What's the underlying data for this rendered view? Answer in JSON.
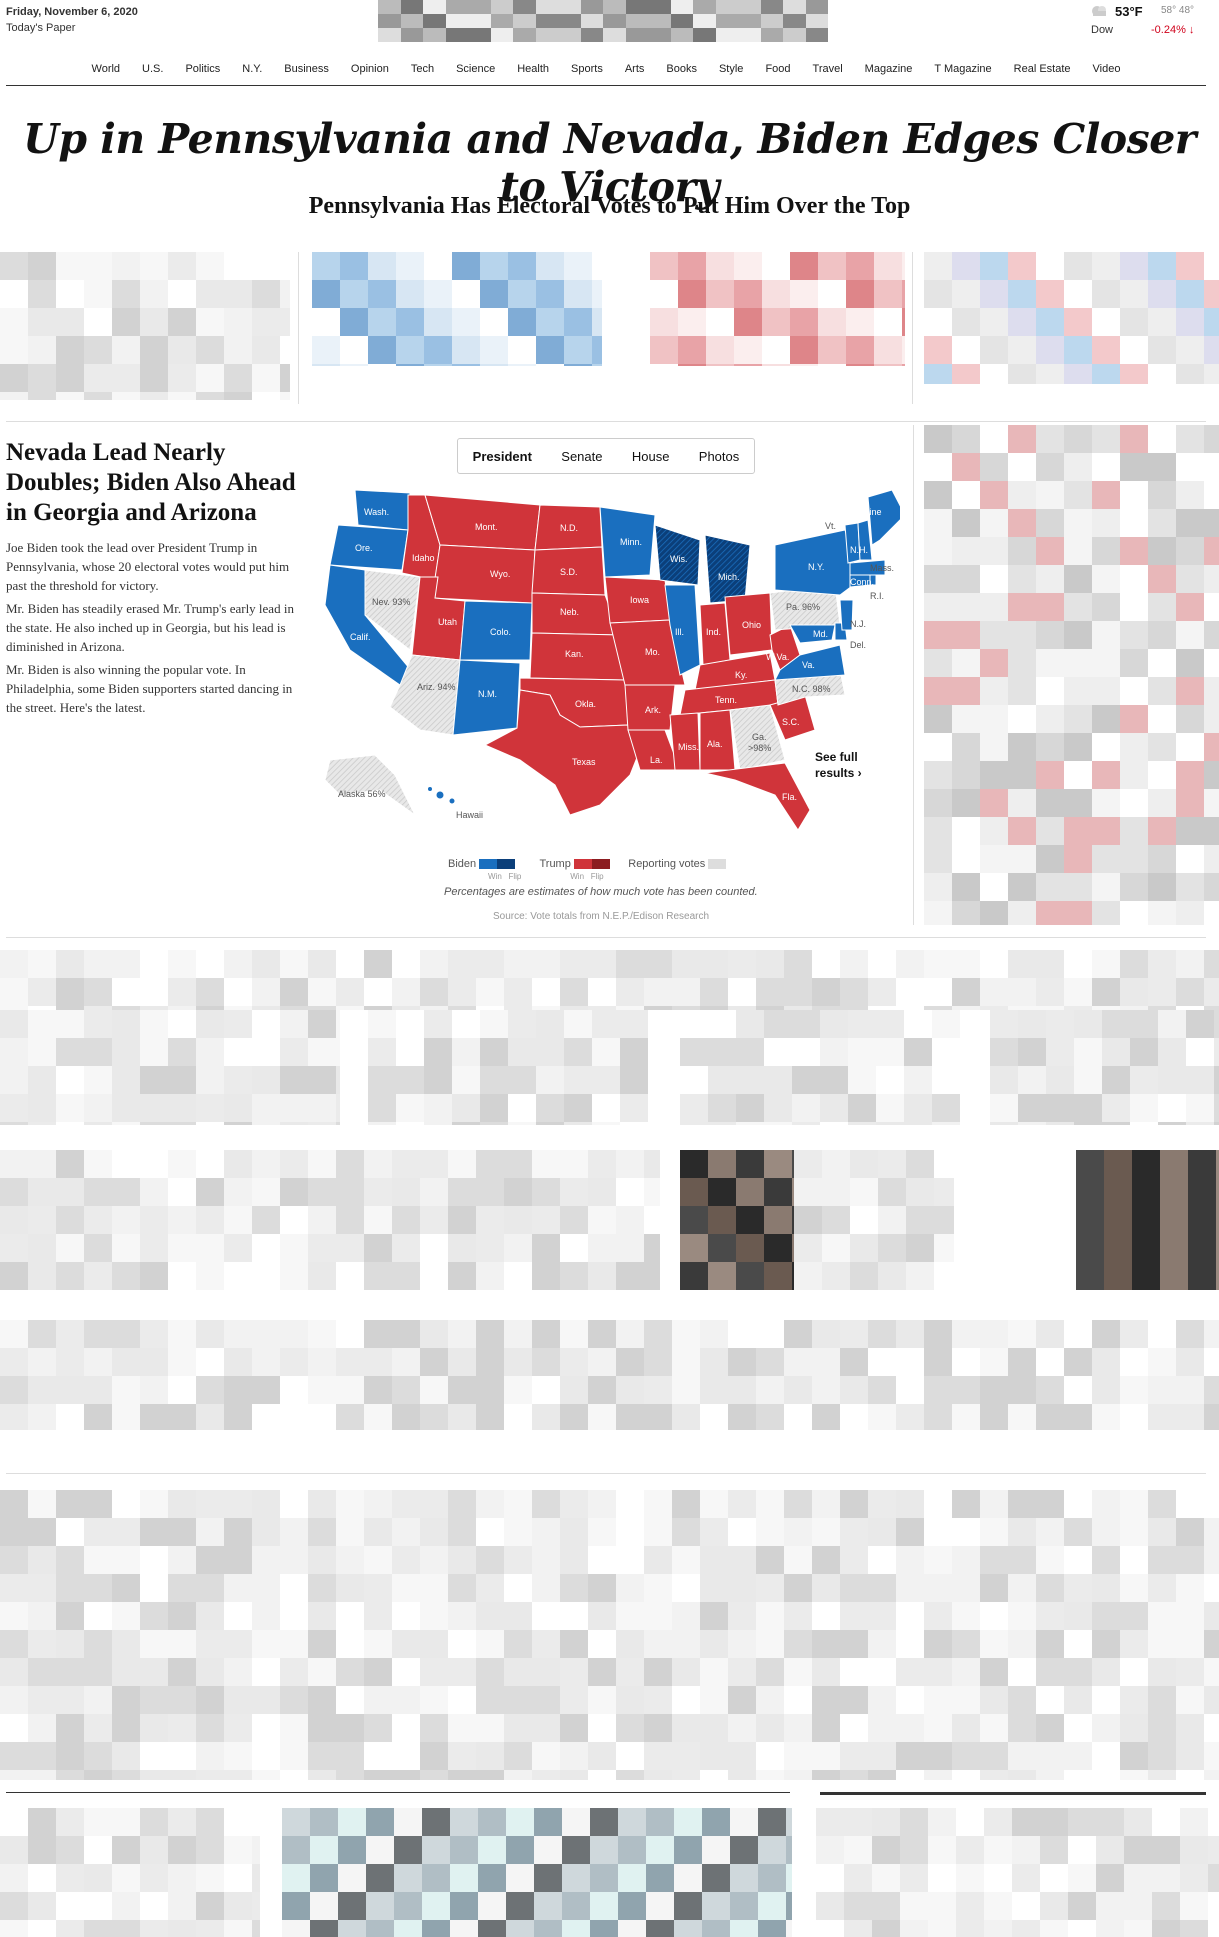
{
  "header": {
    "date": "Friday, November 6, 2020",
    "todays_paper": "Today's Paper",
    "weather": {
      "temp": "53°F",
      "hi": "58°",
      "lo": "48°"
    },
    "market": {
      "label": "Dow",
      "value": "-0.24%"
    }
  },
  "nav": [
    "World",
    "U.S.",
    "Politics",
    "N.Y.",
    "Business",
    "Opinion",
    "Tech",
    "Science",
    "Health",
    "Sports",
    "Arts",
    "Books",
    "Style",
    "Food",
    "Travel",
    "Magazine",
    "T Magazine",
    "Real Estate",
    "Video"
  ],
  "headline": "Up in Pennsylvania and Nevada, Biden Edges Closer to Victory",
  "subheadline": "Pennsylvania Has Electoral Votes to Put Him Over the Top",
  "story": {
    "title": "Nevada Lead Nearly Doubles; Biden Also Ahead in Georgia and Arizona",
    "paragraphs": [
      "Joe Biden took the lead over President Trump in Pennsylvania, whose 20 electoral votes would put him past the threshold for victory.",
      "Mr. Biden has steadily erased Mr. Trump's early lead in the state. He also inched up in Georgia, but his lead is diminished in Arizona.",
      "Mr. Biden is also winning the popular vote. In Philadelphia, some Biden supporters started dancing in the street. Here's the latest."
    ]
  },
  "map_tabs": [
    "President",
    "Senate",
    "House",
    "Photos"
  ],
  "map_labels": {
    "wash": "Wash.",
    "ore": "Ore.",
    "calif": "Calif.",
    "nev": "Nev. 93%",
    "idaho": "Idaho",
    "mont": "Mont.",
    "wyo": "Wyo.",
    "utah": "Utah",
    "colo": "Colo.",
    "ariz": "Ariz. 94%",
    "nm": "N.M.",
    "nd": "N.D.",
    "sd": "S.D.",
    "neb": "Neb.",
    "kan": "Kan.",
    "okla": "Okla.",
    "texas": "Texas",
    "minn": "Minn.",
    "iowa": "Iowa",
    "mo": "Mo.",
    "ark": "Ark.",
    "la": "La.",
    "wis": "Wis.",
    "ill": "Ill.",
    "mich": "Mich.",
    "ind": "Ind.",
    "ohio": "Ohio",
    "ky": "Ky.",
    "tenn": "Tenn.",
    "miss": "Miss.",
    "ala": "Ala.",
    "ga": "Ga.",
    "ga_pct": ">98%",
    "fla": "Fla.",
    "sc": "S.C.",
    "nc": "N.C. 98%",
    "va": "Va.",
    "wva": "W.Va.",
    "pa": "Pa. 96%",
    "md": "Md.",
    "del": "Del.",
    "nj": "N.J.",
    "ny": "N.Y.",
    "conn": "Conn.",
    "ri": "R.I.",
    "mass": "Mass.",
    "vt": "Vt.",
    "nh": "N.H.",
    "maine": "Maine",
    "alaska": "Alaska 56%",
    "hawaii": "Hawaii"
  },
  "see_full_results": {
    "line1": "See full",
    "line2": "results ›"
  },
  "legend": {
    "biden": "Biden",
    "trump": "Trump",
    "reporting": "Reporting votes",
    "win": "Win",
    "flip": "Flip"
  },
  "legend_note": "Percentages are estimates of how much vote has been counted.",
  "source": "Source: Vote totals from N.E.P./Edison Research",
  "colors": {
    "dem": "#1a6fbf",
    "dem_dark": "#0b3f7a",
    "rep": "#d0343a",
    "rep_dark": "#8c1c20",
    "reporting": "#dadada"
  }
}
